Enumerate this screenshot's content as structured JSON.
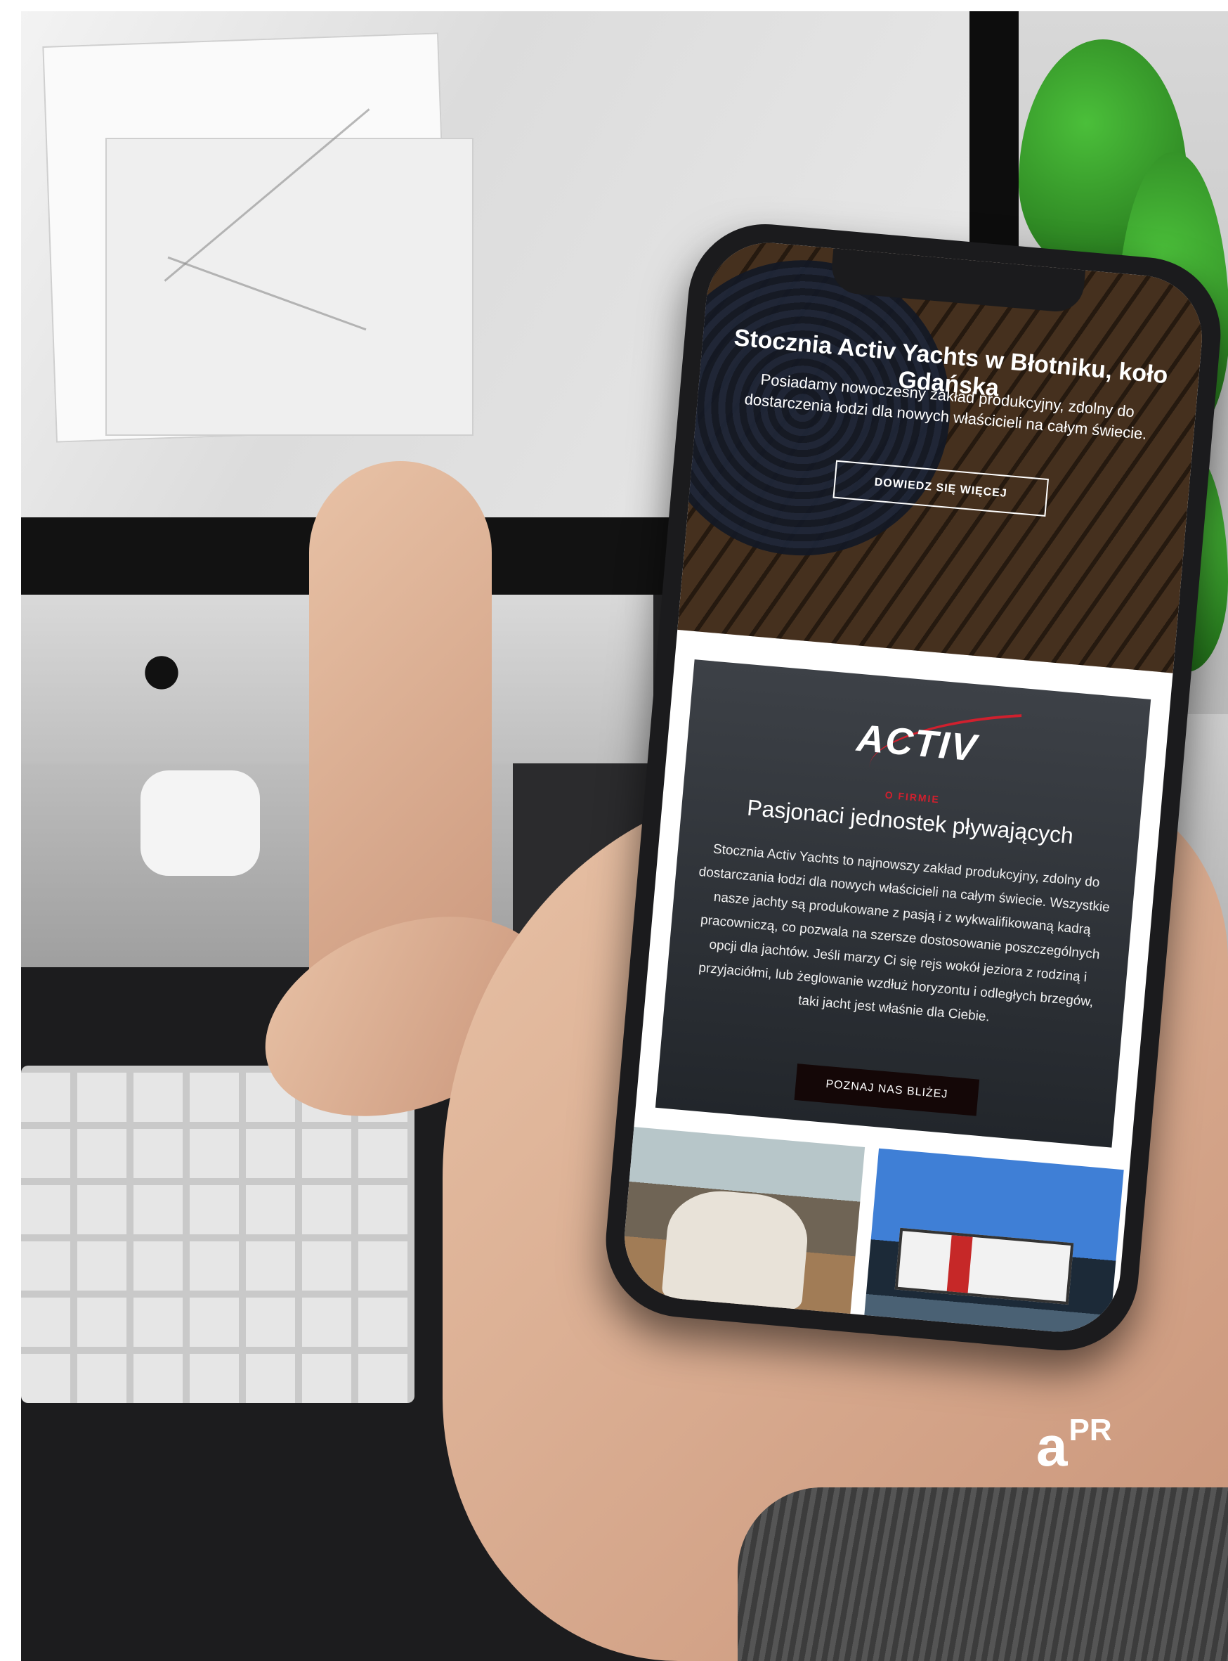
{
  "phone_site": {
    "hero": {
      "title": "Stocznia Activ Yachts w Błotniku, koło Gdańska",
      "text": "Posiadamy nowoczesny zakład produkcyjny, zdolny do dostarczenia łodzi dla nowych właścicieli na całym świecie.",
      "button": "DOWIEDZ SIĘ WIĘCEJ"
    },
    "about": {
      "logo": "ACTIV",
      "eyebrow": "O FIRMIE",
      "title": "Pasjonaci jednostek pływających",
      "text": "Stocznia Activ Yachts to najnowszy zakład produkcyjny, zdolny do dostarczania łodzi dla nowych właścicieli na całym świecie. Wszystkie nasze jachty są produkowane z pasją i z wykwalifikowaną kadrą pracowniczą, co pozwala na szersze dostosowanie poszczególnych opcji dla jachtów. Jeśli marzy Ci się rejs wokół jeziora z rodziną i przyjaciółmi, lub żeglowanie wzdłuż horyzontu i odległych brzegów, taki jacht jest właśnie dla Ciebie.",
      "button": "POZNAJ NAS BLIŻEJ"
    }
  },
  "watermark": {
    "a": "a",
    "pr": "PR"
  },
  "colors": {
    "accent_red": "#d0202e",
    "button_dark": "#140707"
  }
}
